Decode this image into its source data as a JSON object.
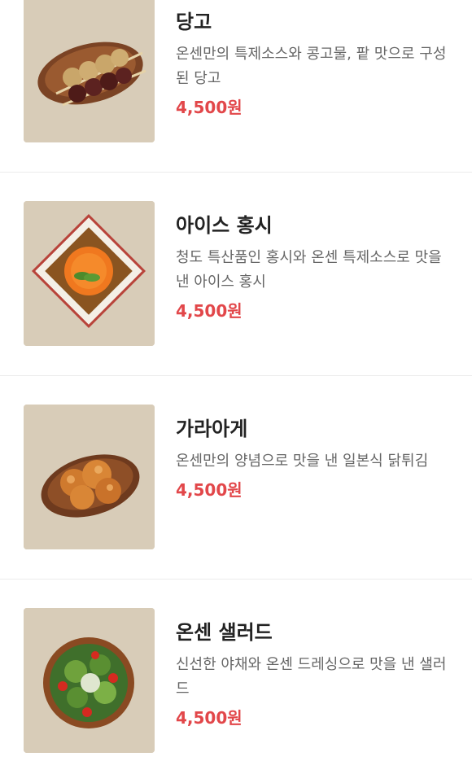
{
  "menu": {
    "items": [
      {
        "name": "당고",
        "description": "온센만의 특제소스와 콩고물, 팥 맛으로 구성 된 당고",
        "price": "4,500원",
        "image_icon": "dango-photo-icon"
      },
      {
        "name": "아이스 홍시",
        "description": "청도 특산품인 홍시와 온센 특제소스로 맛을 낸 아이스 홍시",
        "price": "4,500원",
        "image_icon": "ice-persimmon-photo-icon"
      },
      {
        "name": "가라아게",
        "description": "온센만의 양념으로 맛을 낸 일본식 닭튀김",
        "price": "4,500원",
        "image_icon": "karaage-photo-icon"
      },
      {
        "name": "온센 샐러드",
        "description": "신선한 야채와 온센 드레싱으로 맛을 낸 샐러드",
        "price": "4,500원",
        "image_icon": "salad-photo-icon"
      }
    ]
  },
  "colors": {
    "price": "#e2474a",
    "name": "#222222",
    "description": "#666666",
    "divider": "#ececec",
    "photo_background": "#d9cdb9"
  }
}
